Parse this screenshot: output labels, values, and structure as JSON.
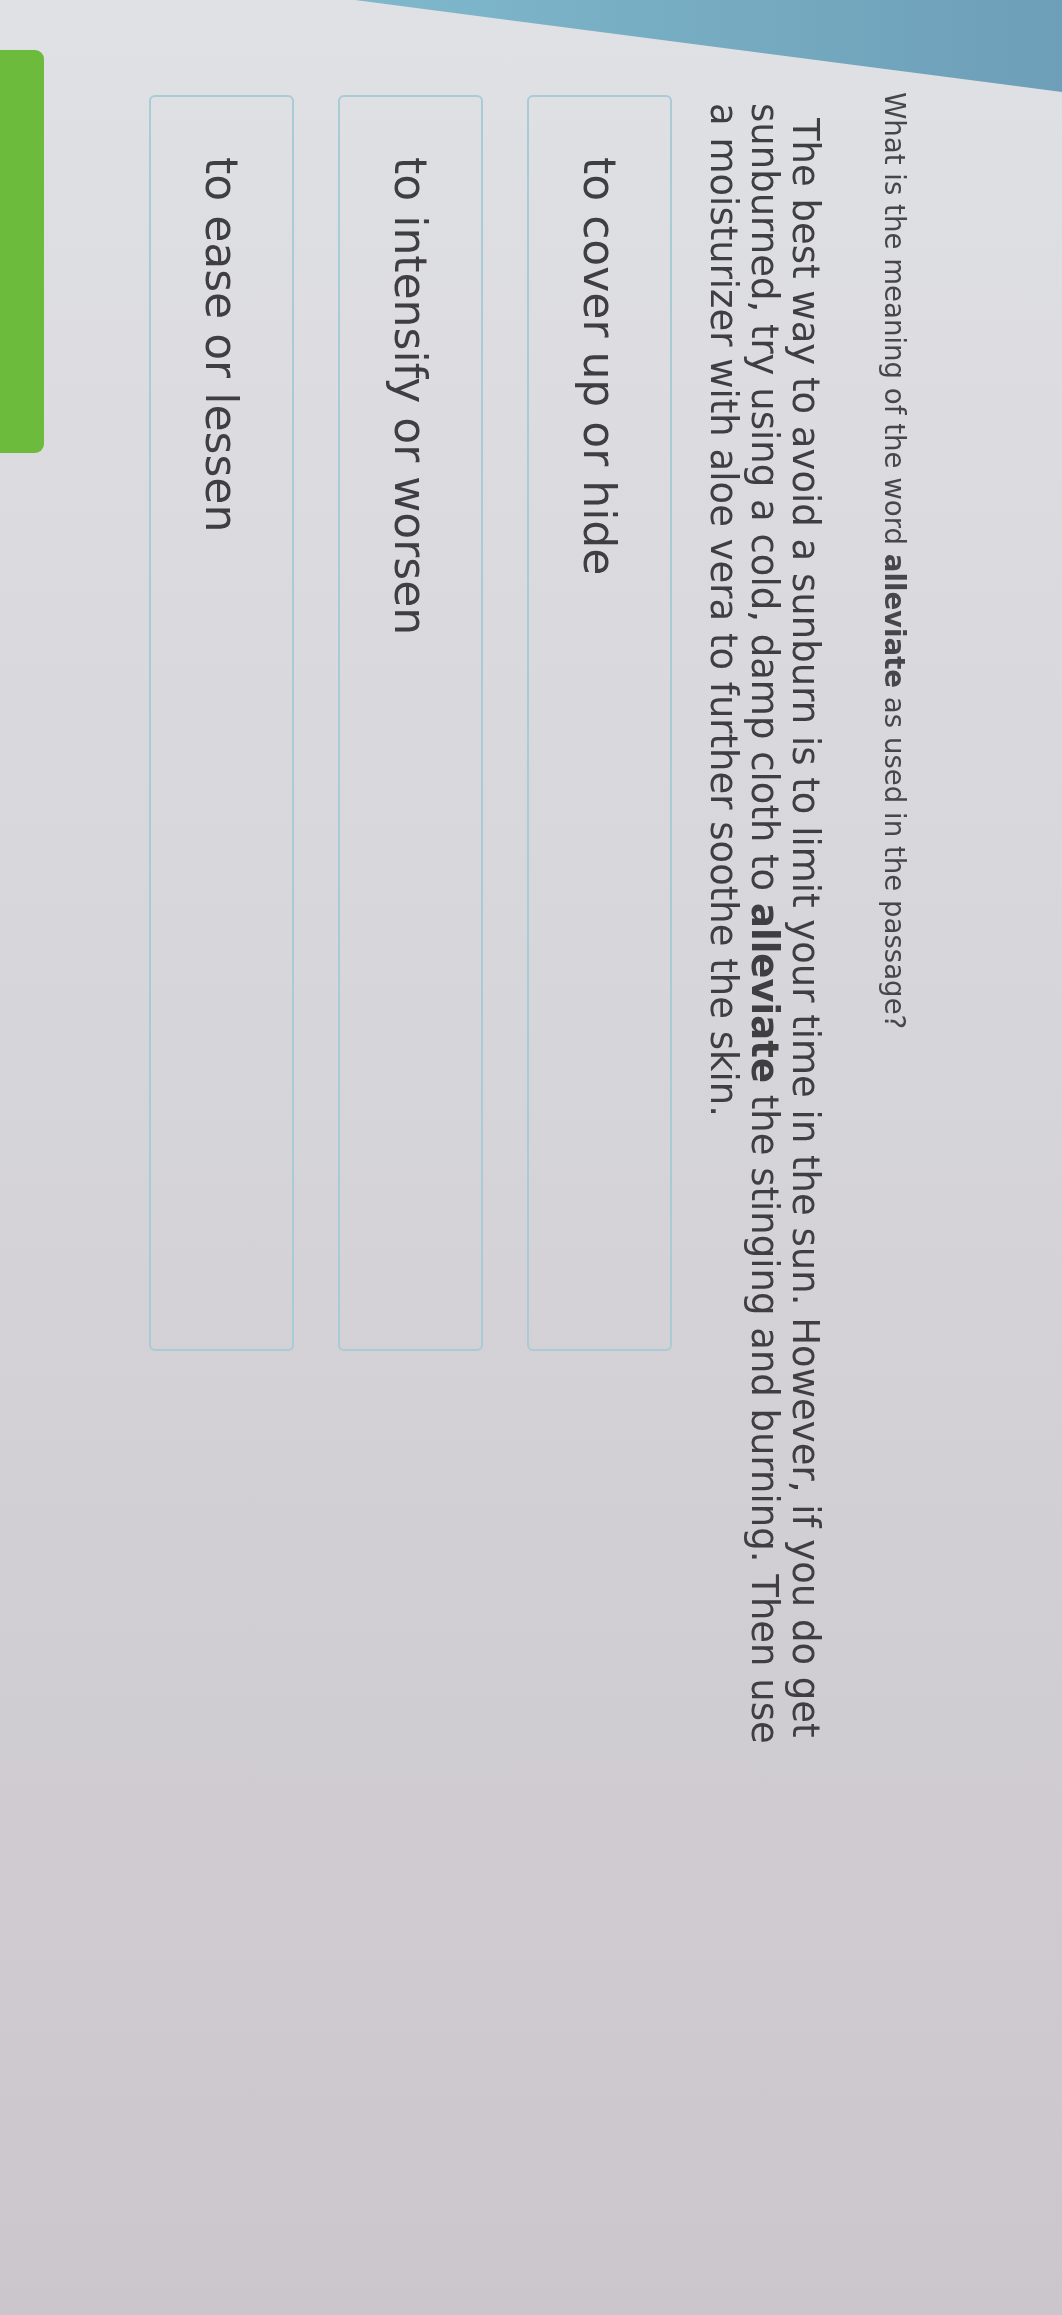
{
  "question": {
    "text": "What is the meaning of the word **alleviate** as used in the passage?"
  },
  "passage": {
    "text": "The best way to avoid a sunburn is to limit your time in the sun. However, if you do get sunburned, try using a cold, damp cloth to **alleviate** the stinging and burning. Then use a moisturizer with aloe vera to further soothe the skin."
  },
  "choices": [
    {
      "label": "to cover up or hide",
      "selected": false
    },
    {
      "label": "to intensify or worsen",
      "selected": false
    },
    {
      "label": "to ease or lessen",
      "selected": false
    }
  ]
}
